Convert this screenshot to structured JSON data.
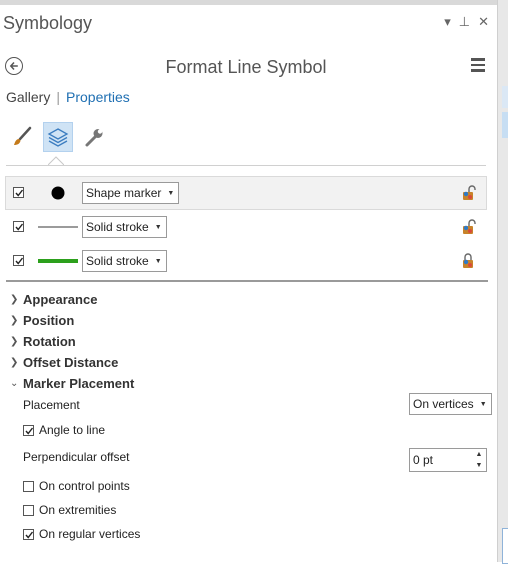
{
  "window": {
    "title": "Symbology",
    "controls": {
      "menu": "▾",
      "pin": "⊥",
      "close": "✕"
    }
  },
  "pane": {
    "title": "Format Line Symbol",
    "tabs": {
      "gallery": "Gallery",
      "separator": "|",
      "properties": "Properties"
    }
  },
  "tools": [
    "paintbrush-icon",
    "layers-icon",
    "wrench-icon"
  ],
  "layers": [
    {
      "checked": true,
      "type": "Shape marker",
      "preview": "black-circle",
      "selected": true
    },
    {
      "checked": true,
      "type": "Solid stroke",
      "preview": "gray-line",
      "color": "#7a7a7a"
    },
    {
      "checked": true,
      "type": "Solid stroke",
      "preview": "green-line",
      "color": "#2ca01c"
    }
  ],
  "sections": [
    {
      "label": "Appearance",
      "expanded": false
    },
    {
      "label": "Position",
      "expanded": false
    },
    {
      "label": "Rotation",
      "expanded": false
    },
    {
      "label": "Offset Distance",
      "expanded": false
    },
    {
      "label": "Marker Placement",
      "expanded": true
    }
  ],
  "marker_placement": {
    "placement_label": "Placement",
    "placement_value": "On vertices",
    "angle_to_line": {
      "label": "Angle to line",
      "checked": true
    },
    "perpendicular_offset_label": "Perpendicular offset",
    "perpendicular_offset_value": "0 pt",
    "on_control_points": {
      "label": "On control points",
      "checked": false
    },
    "on_extremities": {
      "label": "On extremities",
      "checked": false
    },
    "on_regular_vertices": {
      "label": "On regular vertices",
      "checked": true
    }
  },
  "colors": {
    "accent": "#1f6fb2",
    "active_tab_bg": "#cfe3f5"
  }
}
